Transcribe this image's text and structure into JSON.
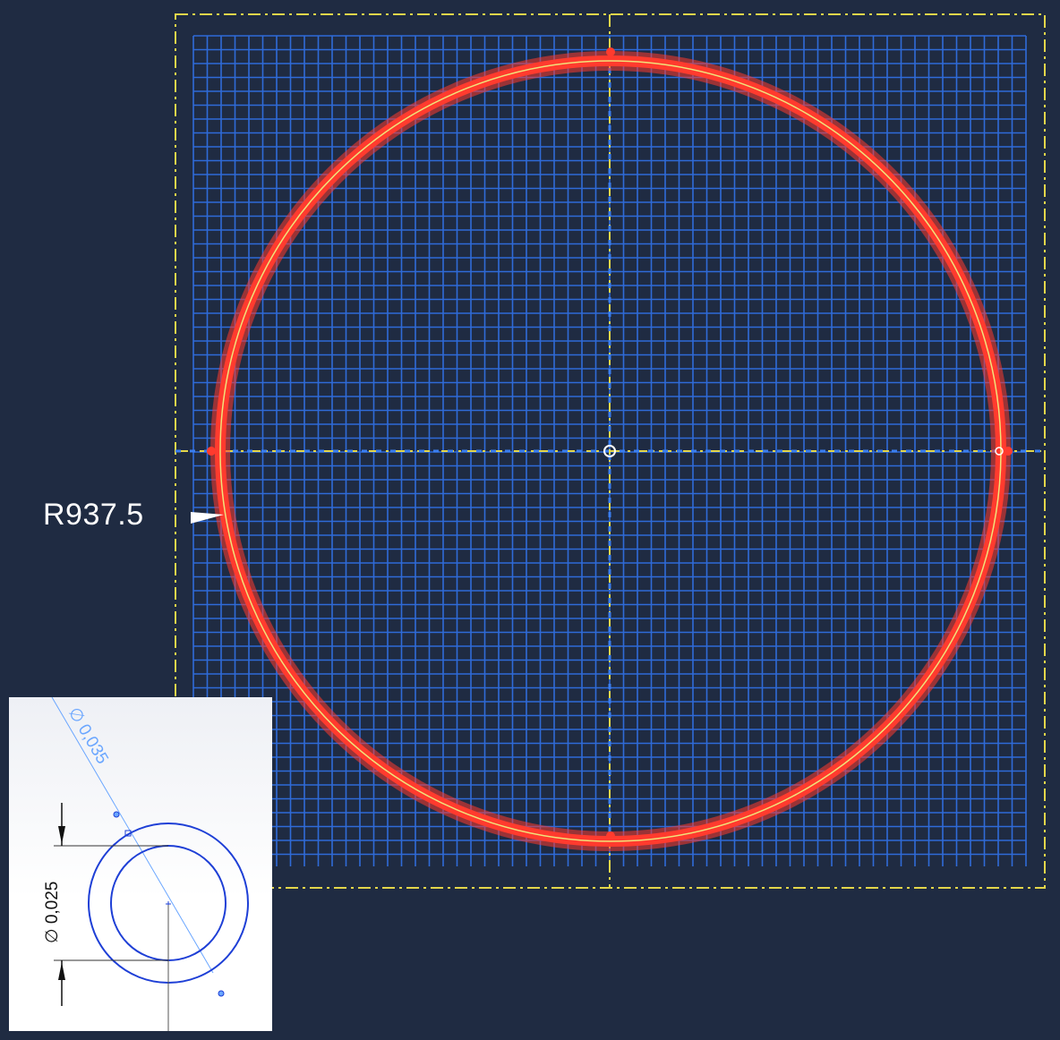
{
  "viewport": {
    "background_color": "#1f2b42",
    "grid_color": "#2f6bd8",
    "circle_highlight_color": "#ff3b2e",
    "circle_core_color": "#f0e27a",
    "construction_line_color": "#e3d64a",
    "axis_line_color": "#3a7ef0"
  },
  "dimension": {
    "radius_label": "R937.5",
    "arrow_icon": "white-arrowhead"
  },
  "inset": {
    "diameter_outer_label": "∅ 0,035",
    "diameter_inner_label": "∅ 0,025",
    "line_color": "#1e3fd6",
    "dim_color": "#6aa6ff"
  }
}
